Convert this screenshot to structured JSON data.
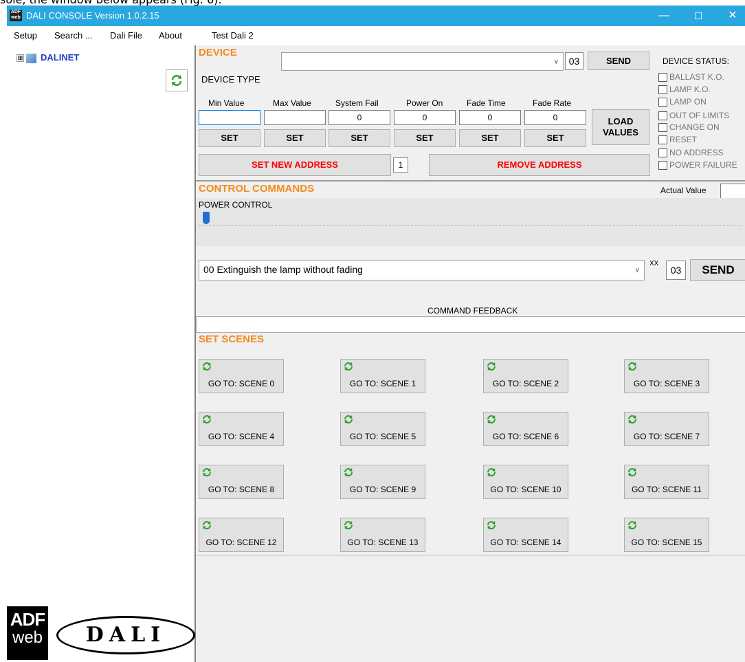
{
  "page_caption": "sole, the window below appears (Fig. 6):",
  "window": {
    "title": "DALI CONSOLE Version 1.0.2.15",
    "icon_text": "ADF\nweb",
    "min": "—",
    "max": "☐",
    "close": "✕"
  },
  "menu": [
    "Setup",
    "Search ...",
    "Dali File",
    "About",
    "Test Dali 2"
  ],
  "tree": {
    "root_label": "DALINET",
    "expander": "⊞"
  },
  "logos": {
    "adf_top": "ADF",
    "adf_bottom": "web",
    "dali": "DALI"
  },
  "device": {
    "title": "DEVICE",
    "combo_value": "",
    "address": "03",
    "send_label": "SEND",
    "device_type_label": "DEVICE TYPE",
    "params": [
      {
        "label": "Min Value",
        "value": "",
        "set": "SET"
      },
      {
        "label": "Max Value",
        "value": "",
        "set": "SET"
      },
      {
        "label": "System Fail",
        "value": "0",
        "set": "SET"
      },
      {
        "label": "Power On",
        "value": "0",
        "set": "SET"
      },
      {
        "label": "Fade Time",
        "value": "0",
        "set": "SET"
      },
      {
        "label": "Fade Rate",
        "value": "0",
        "set": "SET"
      }
    ],
    "load_values_label": "LOAD\nVALUES",
    "set_new_address_label": "SET NEW ADDRESS",
    "new_address_value": "1",
    "remove_address_label": "REMOVE  ADDRESS",
    "red_color": "#ff0000"
  },
  "device_status": {
    "title": "DEVICE STATUS:",
    "items": [
      "BALLAST K.O.",
      "LAMP K.O.",
      "LAMP ON",
      "OUT OF LIMITS",
      "CHANGE ON",
      "RESET",
      "NO ADDRESS",
      "POWER FAILURE"
    ]
  },
  "control": {
    "title": "CONTROL COMMANDS",
    "actual_value_label": "Actual Value",
    "actual_value": "",
    "power_control_label": "POWER CONTROL",
    "power_level": 0,
    "command_value": "00 Extinguish the lamp without fading",
    "xx_label": "XX",
    "address": "03",
    "send_label": "SEND",
    "feedback_label": "COMMAND FEEDBACK",
    "feedback_value": ""
  },
  "scenes": {
    "title": "SET SCENES",
    "icon": "refresh-icon",
    "buttons": [
      "GO TO: SCENE 0",
      "GO TO: SCENE 1",
      "GO TO: SCENE 2",
      "GO TO: SCENE 3",
      "GO TO: SCENE 4",
      "GO TO: SCENE 5",
      "GO TO: SCENE 6",
      "GO TO: SCENE 7",
      "GO TO: SCENE 8",
      "GO TO: SCENE 9",
      "GO TO: SCENE 10",
      "GO TO: SCENE 11",
      "GO TO: SCENE 12",
      "GO TO: SCENE 13",
      "GO TO: SCENE 14",
      "GO TO: SCENE 15"
    ]
  },
  "colors": {
    "accent_orange": "#f28c1c",
    "titlebar": "#29a8e0",
    "tree_blue": "#1a3fbf",
    "refresh_green": "#2ea12e"
  }
}
